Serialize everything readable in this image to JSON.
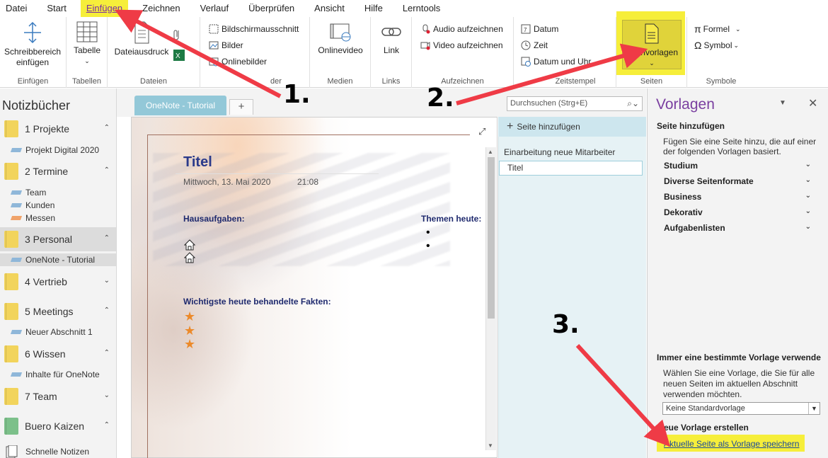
{
  "menu": {
    "tabs": [
      "Datei",
      "Start",
      "Einfügen",
      "Zeichnen",
      "Verlauf",
      "Überprüfen",
      "Ansicht",
      "Hilfe",
      "Lerntools"
    ],
    "active": "Einfügen"
  },
  "ribbon": {
    "einfuegen_group": {
      "button_line1": "Schreibbereich",
      "button_line2": "einfügen",
      "label": "Einfügen"
    },
    "tabellen_group": {
      "button": "Tabelle",
      "label": "Tabellen"
    },
    "dateien_group": {
      "button": "Dateiausdruck",
      "label": "Dateien"
    },
    "bilder_group": {
      "items": [
        "Bildschirmausschnitt",
        "Bilder",
        "Onlinebilder"
      ],
      "label_visible": "der"
    },
    "medien_group": {
      "button": "Onlinevideo",
      "label": "Medien"
    },
    "links_group": {
      "button": "Link",
      "label": "Links"
    },
    "aufzeichnen_group": {
      "items": [
        "Audio aufzeichnen",
        "Video aufzeichnen"
      ],
      "label": "Aufzeichnen"
    },
    "zeitstempel_group": {
      "items": [
        "Datum",
        "Zeit",
        "Datum und Uhr"
      ],
      "label_visible": "Zeitstempel"
    },
    "seiten_group": {
      "button": "envorlagen",
      "label": "Seiten"
    },
    "symbole_group": {
      "items": [
        "Formel",
        "Symbol"
      ],
      "label": "Symbole"
    }
  },
  "notebooks": {
    "title": "Notizbücher",
    "items": [
      {
        "name": "1 Projekte",
        "color": "#f2d45c",
        "chev": "⌃"
      },
      {
        "name": "Projekt Digital 2020",
        "section_color": "#8fb7d9"
      },
      {
        "name": "2 Termine",
        "color": "#f2d45c",
        "chev": "⌃"
      },
      {
        "name": "Team",
        "section_color": "#8fb7d9"
      },
      {
        "name": "Kunden",
        "section_color": "#8fb7d9"
      },
      {
        "name": "Messen",
        "section_color": "#f0a36a"
      },
      {
        "name": "3 Personal",
        "color": "#f2d45c",
        "chev": "⌃"
      },
      {
        "name": "OneNote - Tutorial",
        "section_color": "#8fb7d9"
      },
      {
        "name": "4 Vertrieb",
        "color": "#f2d45c",
        "chev": "⌄"
      },
      {
        "name": "5 Meetings",
        "color": "#f2d45c",
        "chev": "⌃"
      },
      {
        "name": "Neuer Abschnitt 1",
        "section_color": "#8fb7d9"
      },
      {
        "name": "6 Wissen",
        "color": "#f2d45c",
        "chev": "⌃"
      },
      {
        "name": "Inhalte für OneNote",
        "section_color": "#8fb7d9"
      },
      {
        "name": "7 Team",
        "color": "#f2d45c",
        "chev": "⌄"
      },
      {
        "name": "Buero Kaizen",
        "color": "#7cc08a",
        "chev": "⌃"
      },
      {
        "name": "Schnelle Notizen"
      }
    ]
  },
  "tabs": {
    "current": "OneNote - Tutorial",
    "add": "+"
  },
  "search": {
    "placeholder": "Durchsuchen (Strg+E)"
  },
  "page": {
    "title": "Titel",
    "date": "Mittwoch, 13. Mai 2020",
    "time": "21:08",
    "homework": "Hausaufgaben:",
    "topics": "Themen heute:",
    "facts": "Wichtigste heute behandelte Fakten:"
  },
  "pagelist": {
    "add": "Seite hinzufügen",
    "pages": [
      "Einarbeitung neue Mitarbeiter",
      "Titel"
    ]
  },
  "templates": {
    "title": "Vorlagen",
    "add_head": "Seite hinzufügen",
    "add_desc_1": "Fügen Sie eine Seite hinzu, die auf einer",
    "add_desc_2": "der folgenden Vorlagen basiert.",
    "categories": [
      "Studium",
      "Diverse Seitenformate",
      "Business",
      "Dekorativ",
      "Aufgabenlisten"
    ],
    "always_head": "Immer eine bestimmte Vorlage verwende",
    "always_desc_1": "Wählen Sie eine Vorlage, die Sie für alle",
    "always_desc_2": "neuen Seiten im aktuellen Abschnitt",
    "always_desc_3": "verwenden möchten.",
    "select_value": "Keine Standardvorlage",
    "new_head": "eue Vorlage erstellen",
    "save_link": "Aktuelle Seite als Vorlage speichern"
  },
  "annotations": [
    "1.",
    "2.",
    "3."
  ],
  "colors": {
    "highlight": "#f6ee3a",
    "accent": "#7a3fa0",
    "arrow": "#ef3b46",
    "tab": "#93c8d8"
  }
}
